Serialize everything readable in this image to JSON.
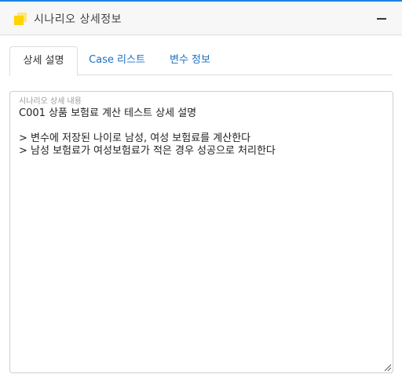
{
  "panel": {
    "title": "시나리오 상세정보",
    "header_icon": "stacked-squares-icon",
    "collapse_icon": "minus-icon",
    "accent_color": "#1a82e2",
    "icon_color": "#ffd400"
  },
  "tabs": [
    {
      "label": "상세 설명",
      "active": true
    },
    {
      "label": "Case 리스트",
      "active": false
    },
    {
      "label": "변수 정보",
      "active": false
    }
  ],
  "description": {
    "label": "시나리오 상세 내용",
    "value": "C001 상품 보험료 계산 테스트 상세 설명\n\n> 변수에 저장된 나이로 남성, 여성 보험료를 계산한다\n> 남성 보험료가 여성보험료가 적은 경우 성공으로 처리한다"
  }
}
